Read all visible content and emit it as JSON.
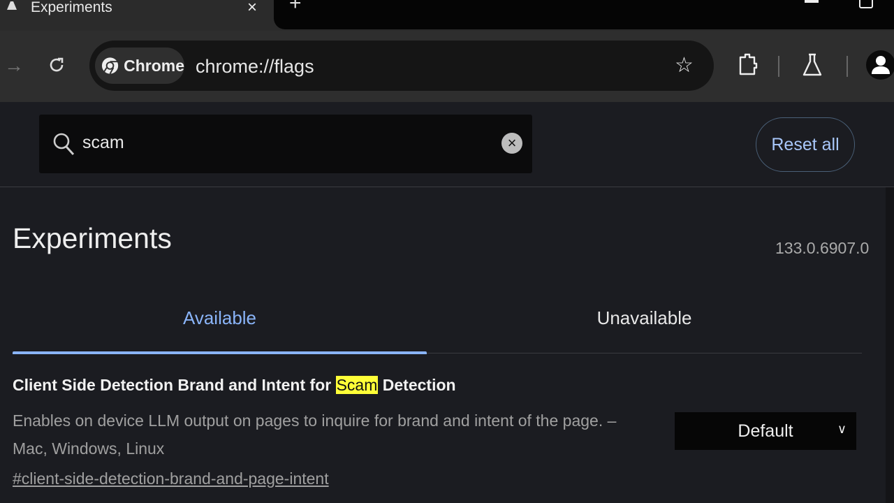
{
  "tab": {
    "title": "Experiments",
    "close": "×",
    "new_tab": "+"
  },
  "toolbar": {
    "forward_icon": "arrow-right-icon",
    "reload_icon": "reload-icon",
    "chip_label": "Chrome",
    "url": "chrome://flags",
    "bookmark_icon": "star-icon",
    "extensions_icon": "puzzle-icon",
    "labs_icon": "flask-icon",
    "profile_icon": "avatar-icon"
  },
  "search": {
    "value": "scam",
    "clear": "×"
  },
  "reset_label": "Reset all",
  "page": {
    "title": "Experiments",
    "version": "133.0.6907.0"
  },
  "tabs": [
    {
      "label": "Available",
      "active": true
    },
    {
      "label": "Unavailable",
      "active": false
    }
  ],
  "flag": {
    "title_before": "Client Side Detection Brand and Intent for ",
    "title_highlight": "Scam",
    "title_after": " Detection",
    "description": "Enables on device LLM output on pages to inquire for brand and intent of the page. – Mac, Windows, Linux",
    "link": "#client-side-detection-brand-and-page-intent",
    "selected": "Default"
  },
  "colors": {
    "accent": "#8ab4f8",
    "highlight": "#ffff38",
    "background": "#1b1c21"
  }
}
